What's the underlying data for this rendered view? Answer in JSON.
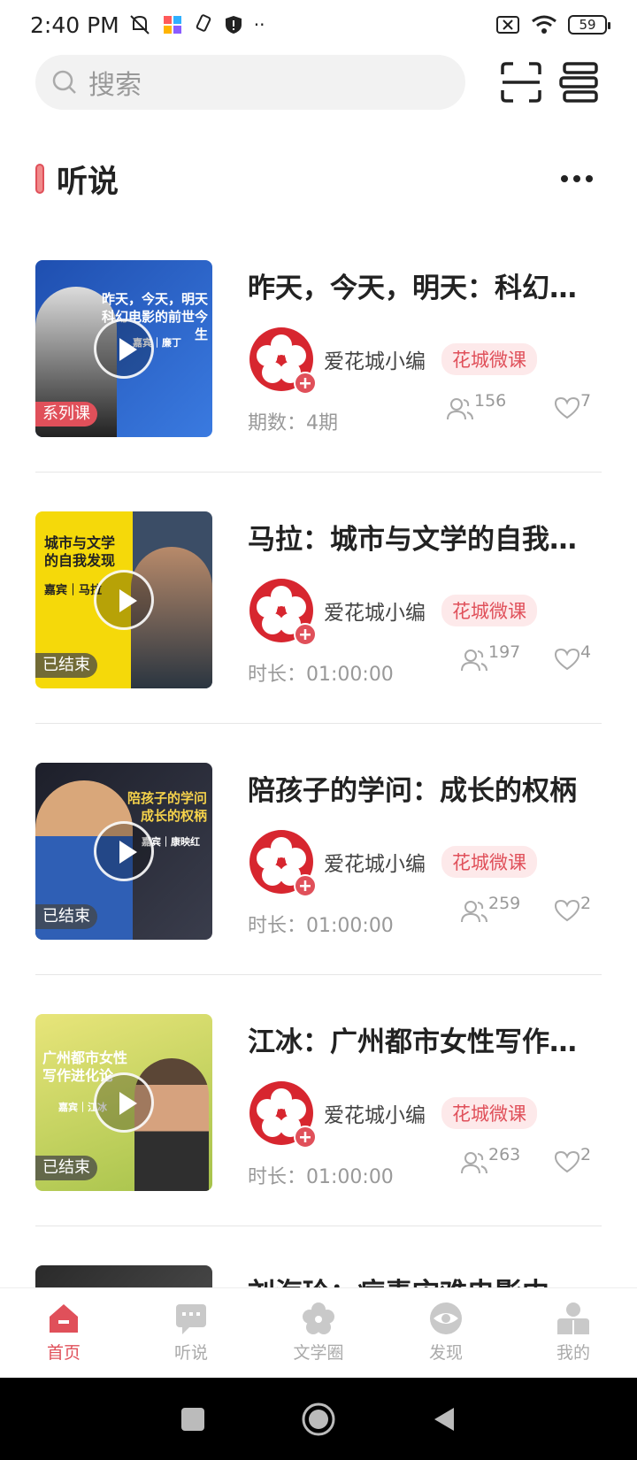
{
  "status_bar": {
    "time": "2:40 PM",
    "battery": "59",
    "icons": [
      "mute-icon",
      "app-icon",
      "brush-icon",
      "shield-icon",
      "more-dots-icon",
      "sim-off-icon",
      "wifi-icon",
      "battery-icon"
    ]
  },
  "search": {
    "placeholder": "搜索"
  },
  "top_actions": [
    "scan-icon",
    "bookshelf-icon"
  ],
  "section": {
    "title": "听说"
  },
  "items": [
    {
      "title": "昨天，今天，明天：科幻电影的前世今生",
      "thumb_text": "昨天，今天，明天 科幻电影的前世今生",
      "thumb_guest": "嘉宾｜廉丁",
      "badge": "系列课",
      "author": "爱花城小编",
      "tag": "花城微课",
      "meta": "期数：4期",
      "listeners": "156",
      "likes": "7"
    },
    {
      "title": "马拉：城市与文学的自我发现",
      "thumb_text": "城市与文学 的自我发现",
      "thumb_guest": "嘉宾｜马拉",
      "badge": "已结束",
      "author": "爱花城小编",
      "tag": "花城微课",
      "meta": "时长：01:00:00",
      "listeners": "197",
      "likes": "4"
    },
    {
      "title": "陪孩子的学问：成长的权柄",
      "thumb_text": "陪孩子的学问 成长的权柄",
      "thumb_guest": "嘉宾｜康映红",
      "badge": "已结束",
      "author": "爱花城小编",
      "tag": "花城微课",
      "meta": "时长：01:00:00",
      "listeners": "259",
      "likes": "2"
    },
    {
      "title": "江冰：广州都市女性写作进化论",
      "thumb_text": "广州都市女性 写作进化论",
      "thumb_guest": "嘉宾｜江冰",
      "badge": "已结束",
      "author": "爱花城小编",
      "tag": "花城微课",
      "meta": "时长：01:00:00",
      "listeners": "263",
      "likes": "2"
    },
    {
      "title": "刘海玲：病毒灾难电影中",
      "thumb_text": "",
      "thumb_guest": "",
      "badge": "",
      "author": "",
      "tag": "",
      "meta": "",
      "listeners": "",
      "likes": ""
    }
  ],
  "nav": {
    "items": [
      {
        "label": "首页",
        "icon": "home-icon",
        "active": true
      },
      {
        "label": "听说",
        "icon": "chat-icon",
        "active": false
      },
      {
        "label": "文学圈",
        "icon": "flower-icon",
        "active": false
      },
      {
        "label": "发现",
        "icon": "eye-icon",
        "active": false
      },
      {
        "label": "我的",
        "icon": "profile-icon",
        "active": false
      }
    ]
  },
  "colors": {
    "accent": "#e0505a",
    "muted": "#999999"
  }
}
